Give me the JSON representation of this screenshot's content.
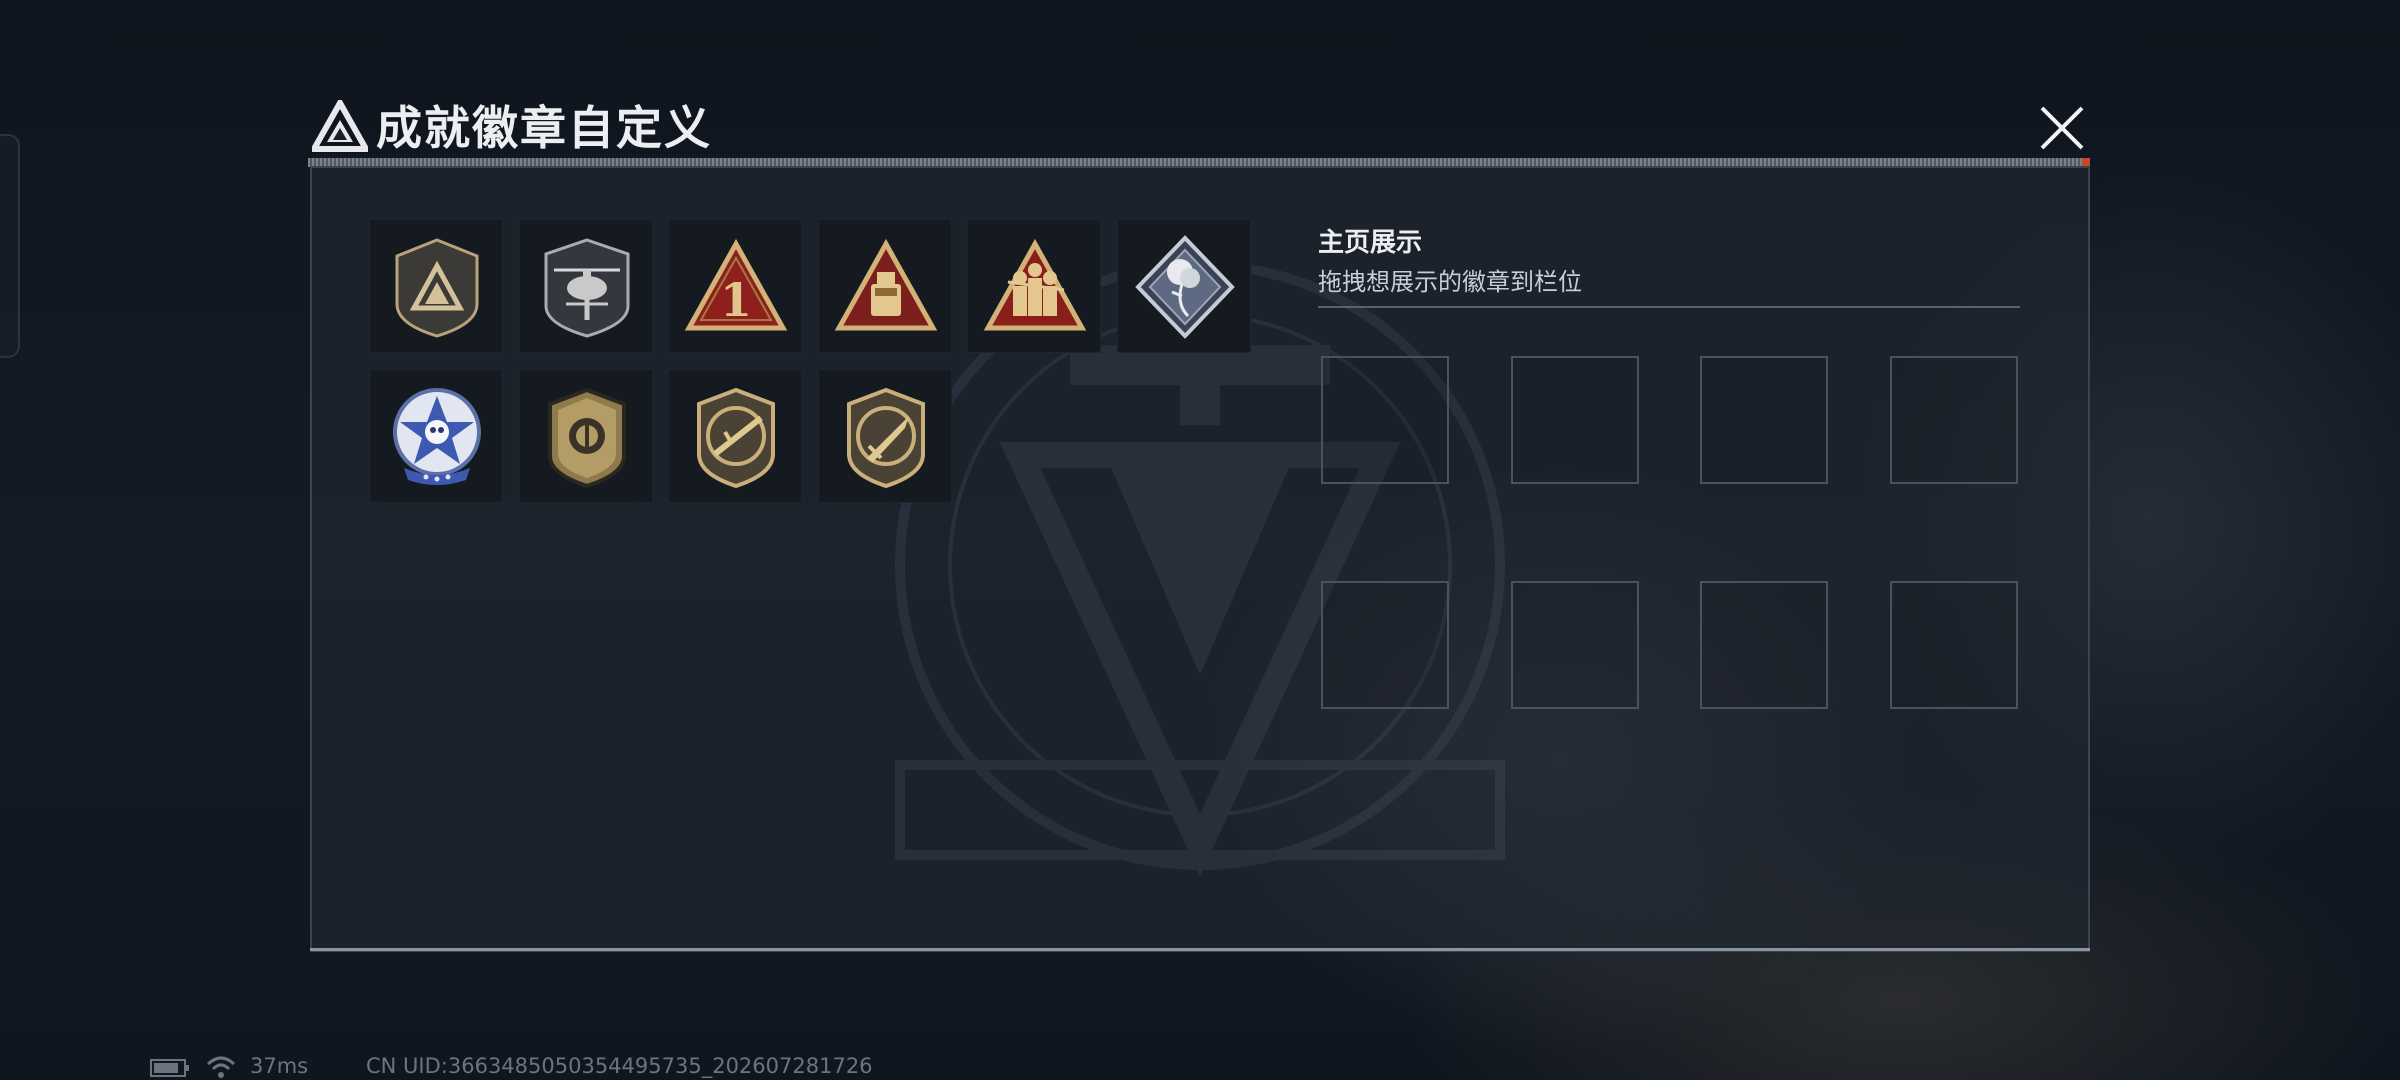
{
  "header": {
    "title": "成就徽章自定义",
    "close_label": "close"
  },
  "badges": [
    {
      "name": "triangle-shield-badge"
    },
    {
      "name": "helicopter-shield-badge"
    },
    {
      "name": "rank-one-triangle-badge"
    },
    {
      "name": "usb-drive-triangle-badge"
    },
    {
      "name": "soldiers-triangle-badge"
    },
    {
      "name": "rose-diamond-badge"
    },
    {
      "name": "star-skull-seal-badge"
    },
    {
      "name": "token-shield-badge"
    },
    {
      "name": "rifle-shield-badge"
    },
    {
      "name": "knife-shield-badge"
    }
  ],
  "showcase": {
    "title": "主页展示",
    "subtitle": "拖拽想展示的徽章到栏位",
    "slot_count": 8
  },
  "status": {
    "ping": "37ms",
    "uid": "CN UID:3663485050354495735_202607281726"
  },
  "colors": {
    "panel_bg": "#222832",
    "gold": "#c8a86a",
    "red_badge": "#8e1f1c",
    "accent_red": "#c2482e"
  }
}
